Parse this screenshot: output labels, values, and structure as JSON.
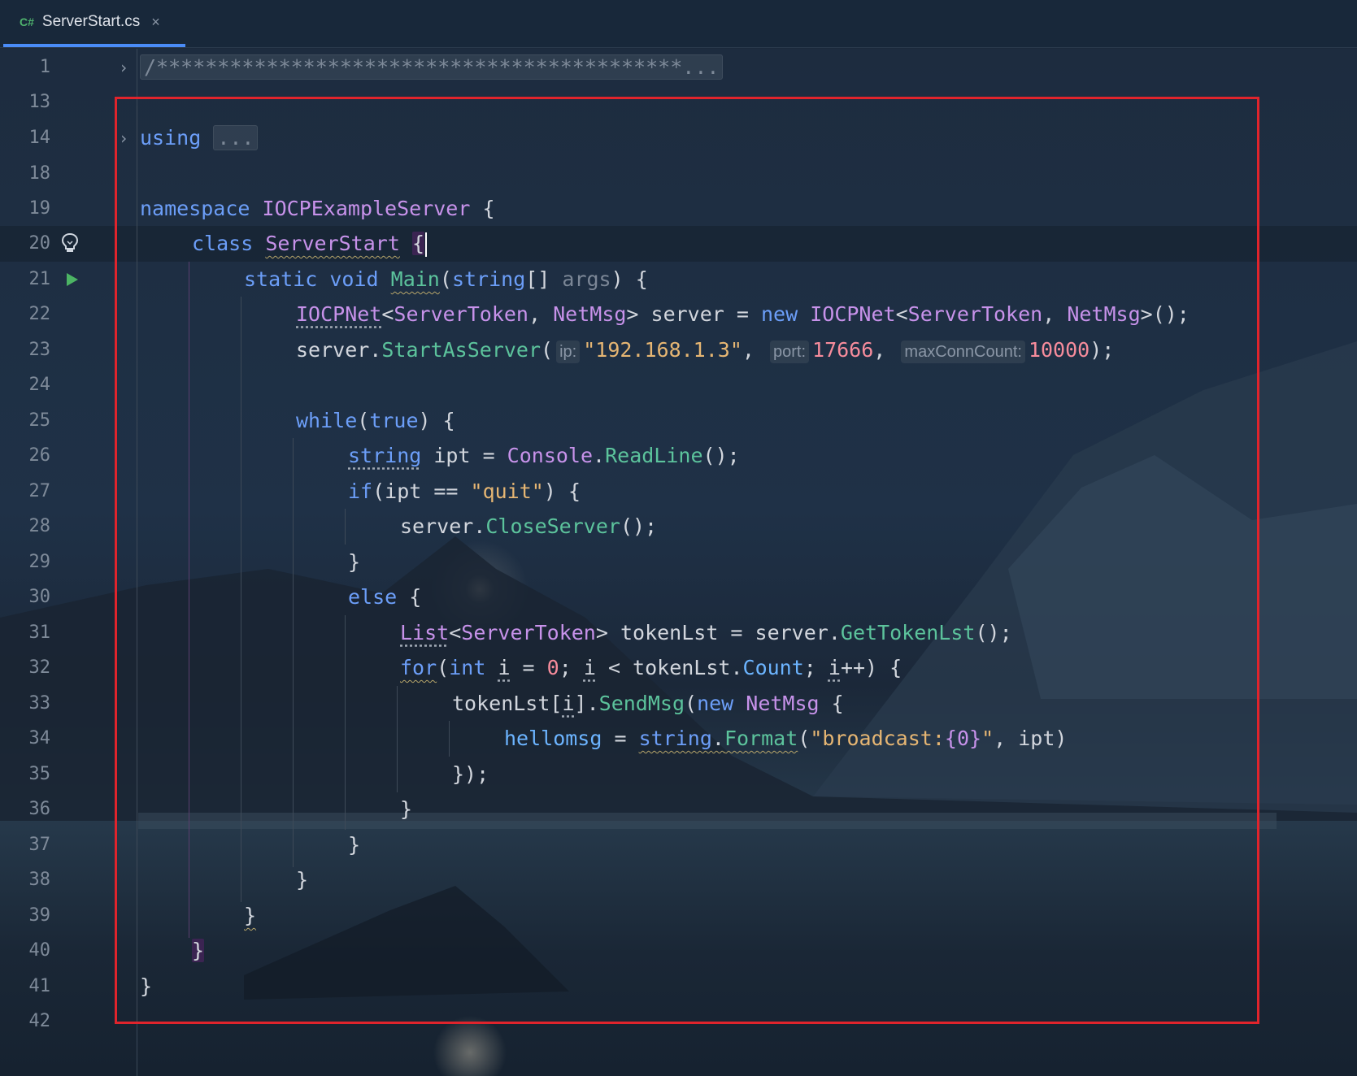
{
  "tab": {
    "lang_badge": "C#",
    "title": "ServerStart.cs",
    "close_glyph": "×"
  },
  "line_numbers": [
    "1",
    "13",
    "14",
    "18",
    "19",
    "20",
    "21",
    "22",
    "23",
    "24",
    "25",
    "26",
    "27",
    "28",
    "29",
    "30",
    "31",
    "32",
    "33",
    "34",
    "35",
    "36",
    "37",
    "38",
    "39",
    "40",
    "41",
    "42"
  ],
  "code": {
    "l1_comment": "/*******************************************",
    "l1_ellipsis": "...",
    "l14_using": "using",
    "l14_fold": "...",
    "l19_namespace": "namespace",
    "l19_name": "IOCPExampleServer",
    "l19_brace": " {",
    "l20_class": "class",
    "l20_name": "ServerStart",
    "l20_brace": "{",
    "l21_static": "static",
    "l21_void": "void",
    "l21_main": "Main",
    "l21_open": "(",
    "l21_string": "string",
    "l21_arr": "[] ",
    "l21_args": "args",
    "l21_close": ") {",
    "l22_iocp": "IOCPNet",
    "l22_lt": "<",
    "l22_token": "ServerToken",
    "l22_comma": ", ",
    "l22_msg": "NetMsg",
    "l22_mid": "> server = ",
    "l22_new": "new",
    "l22_iocp2": "IOCPNet",
    "l22_lt2": "<",
    "l22_token2": "ServerToken",
    "l22_comma2": ", ",
    "l22_msg2": "NetMsg",
    "l22_end": ">();",
    "l23_server": "server.",
    "l23_method": "StartAsServer",
    "l23_open": "(",
    "l23_hint_ip": "ip:",
    "l23_ip": "\"192.168.1.3\"",
    "l23_comma": ", ",
    "l23_hint_port": "port:",
    "l23_port": "17666",
    "l23_comma2": ", ",
    "l23_hint_max": "maxConnCount:",
    "l23_max": "10000",
    "l23_end": ");",
    "l25_while": "while",
    "l25_open": "(",
    "l25_true": "true",
    "l25_end": ") {",
    "l26_string": "string",
    "l26_mid": " ipt = ",
    "l26_console": "Console",
    "l26_dot": ".",
    "l26_readline": "ReadLine",
    "l26_end": "();",
    "l27_if": "if",
    "l27_mid": "(ipt == ",
    "l27_quit": "\"quit\"",
    "l27_end": ") {",
    "l28_server": "server.",
    "l28_close": "CloseServer",
    "l28_end": "();",
    "l29_brace": "}",
    "l30_else": "else",
    "l30_brace": " {",
    "l31_list": "List",
    "l31_lt": "<",
    "l31_token": "ServerToken",
    "l31_mid": "> tokenLst = server.",
    "l31_get": "GetTokenLst",
    "l31_end": "();",
    "l32_for": "for",
    "l32_open": "(",
    "l32_int": "int",
    "l32_sp": " ",
    "l32_i": "i",
    "l32_eq": " = ",
    "l32_zero": "0",
    "l32_semi": "; ",
    "l32_i2": "i",
    "l32_lt": " < tokenLst.",
    "l32_count": "Count",
    "l32_semi2": "; ",
    "l32_i3": "i",
    "l32_end": "++) {",
    "l33_token": "tokenLst[",
    "l33_i": "i",
    "l33_close": "].",
    "l33_send": "SendMsg",
    "l33_open": "(",
    "l33_new": "new",
    "l33_sp": " ",
    "l33_msg": "NetMsg",
    "l33_brace": " {",
    "l34_hello": "hellomsg",
    "l34_eq": " = ",
    "l34_string": "string",
    "l34_dot": ".",
    "l34_format": "Format",
    "l34_open": "(",
    "l34_str": "\"broadcast:",
    "l34_ph": "{0}",
    "l34_strend": "\"",
    "l34_end": ", ipt)",
    "l35_close": "});",
    "l36_brace": "}",
    "l37_brace": "}",
    "l38_brace": "}",
    "l39_brace": "}",
    "l40_brace": "}",
    "l41_brace": "}"
  },
  "colors": {
    "keyword": "#6c9ef8",
    "type": "#c792ea",
    "method": "#5cc39c",
    "string": "#e6b673",
    "number": "#f78c9c",
    "selection_border": "#e0242c",
    "tab_underline": "#4a8cf7"
  },
  "icons": {
    "fold": "chevron-right-icon",
    "bulb": "lightbulb-icon",
    "run": "run-triangle-icon"
  }
}
